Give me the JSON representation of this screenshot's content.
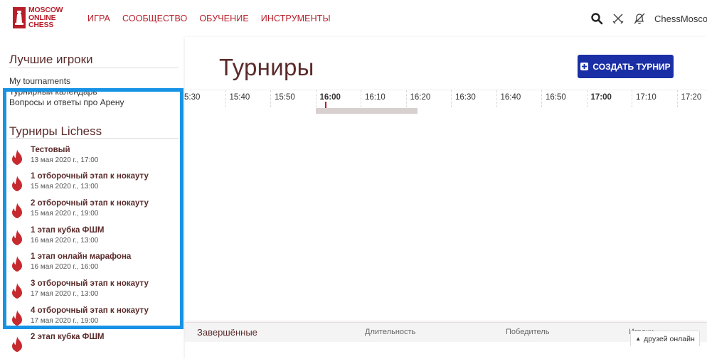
{
  "brand": {
    "logo_line1": "MOSCOW",
    "logo_line2": "ONLINE",
    "logo_line3": "CHESS"
  },
  "nav": [
    {
      "label": "ИГРА"
    },
    {
      "label": "СООБЩЕСТВО"
    },
    {
      "label": "ОБУЧЕНИЕ"
    },
    {
      "label": "ИНСТРУМЕНТЫ"
    }
  ],
  "header_icons": [
    "search-icon",
    "swords-icon",
    "bell-off-icon"
  ],
  "user": {
    "name": "ChessMoscow"
  },
  "sidebar": {
    "best_players_title": "Лучшие игроки",
    "links": [
      {
        "label": "My tournaments"
      },
      {
        "label": "Турнирный календарь"
      },
      {
        "label": "Вопросы и ответы про Арену"
      }
    ],
    "lichess_title": "Турниры Lichess",
    "tournaments": [
      {
        "name": "Тестовый",
        "date": "13 мая 2020 г., 17:00"
      },
      {
        "name": "1 отборочный этап к нокауту",
        "date": "15 мая 2020 г., 13:00"
      },
      {
        "name": "2 отборочный этап к нокауту",
        "date": "15 мая 2020 г., 19:00"
      },
      {
        "name": "1 этап кубка ФШМ",
        "date": "16 мая 2020 г., 13:00"
      },
      {
        "name": "1 этап онлайн марафона",
        "date": "16 мая 2020 г., 16:00"
      },
      {
        "name": "3 отборочный этап к нокауту",
        "date": "17 мая 2020 г., 13:00"
      },
      {
        "name": "4 отборочный этап к нокауту",
        "date": "17 мая 2020 г., 19:00"
      },
      {
        "name": "2 этап кубка ФШМ",
        "date": ""
      }
    ]
  },
  "main": {
    "title": "Турниры",
    "create_button": "СОЗДАТЬ ТУРНИР",
    "timeline": [
      "5:30",
      "15:40",
      "15:50",
      "16:00",
      "16:10",
      "16:20",
      "16:30",
      "16:40",
      "16:50",
      "17:00",
      "17:10",
      "17:20"
    ],
    "timeline_bold": [
      "16:00",
      "17:00"
    ],
    "table_headers": [
      "Завершённые",
      "Длительность",
      "Победитель",
      "Игроки"
    ]
  },
  "friends_button": "друзей онлайн",
  "colors": {
    "brand_red": "#b81e2a",
    "button_blue": "#1a2fa5",
    "highlight": "#1793e6",
    "text_brown": "#5b2b2b"
  }
}
